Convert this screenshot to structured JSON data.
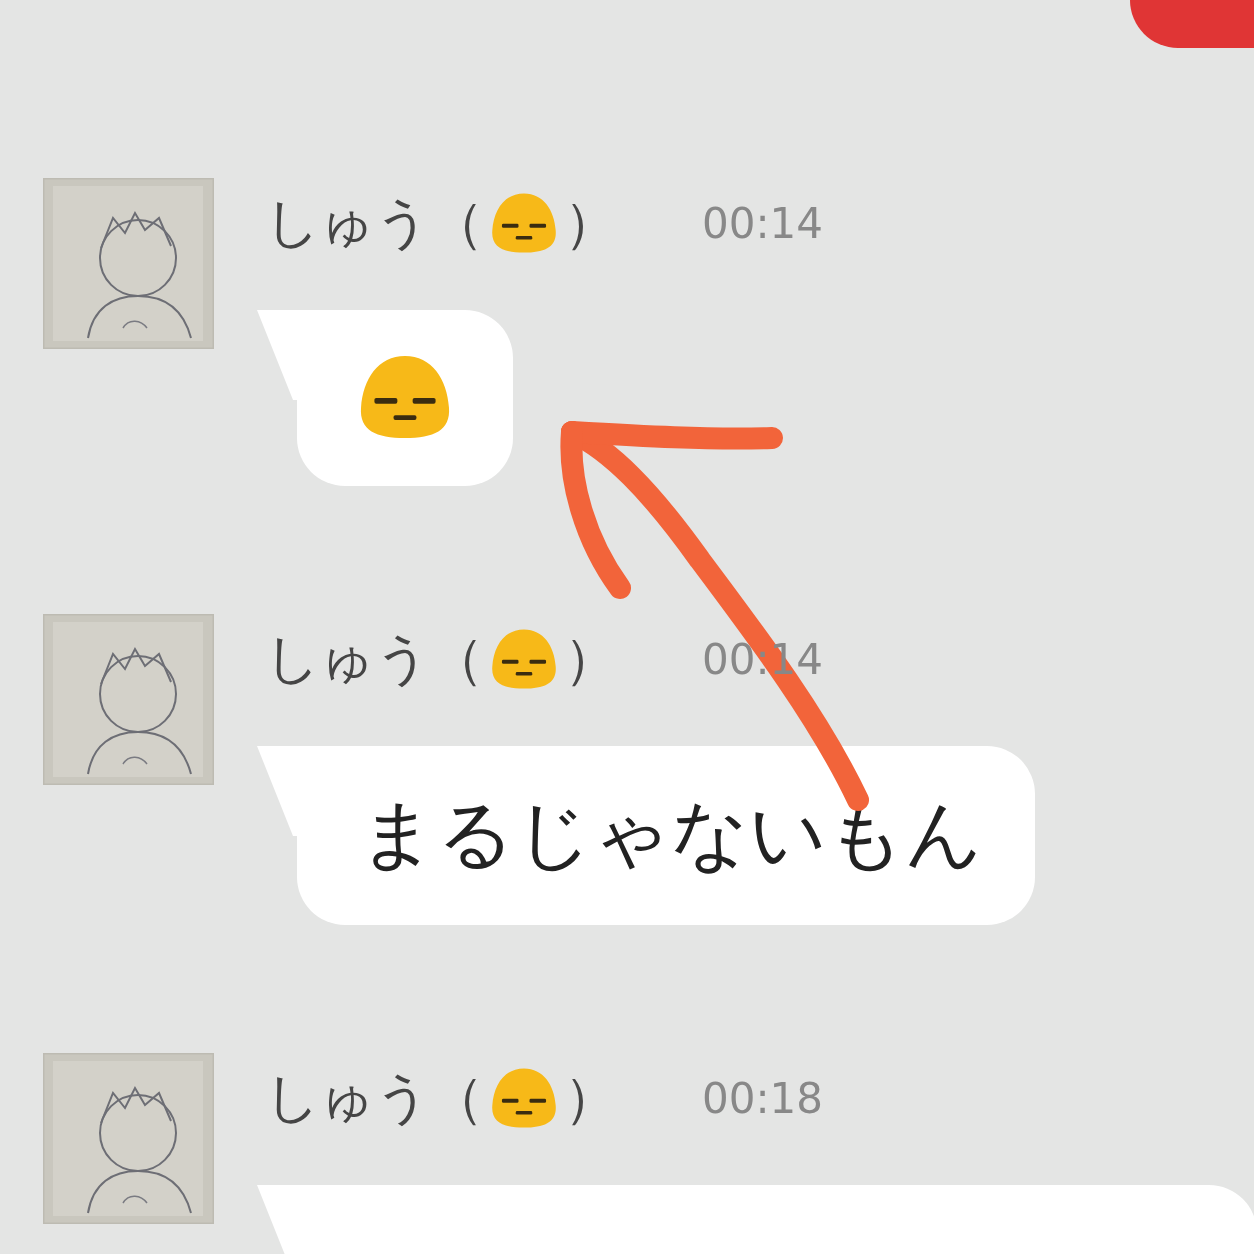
{
  "messages": [
    {
      "sender": "しゅう",
      "paren_open": "（",
      "paren_close": "）",
      "time": "00:14",
      "kind": "emoji"
    },
    {
      "sender": "しゅう",
      "paren_open": "（",
      "paren_close": "）",
      "time": "00:14",
      "kind": "text",
      "text": "まるじゃないもん"
    },
    {
      "sender": "しゅう",
      "paren_open": "（",
      "paren_close": "）",
      "time": "00:18",
      "kind": "blank"
    }
  ]
}
